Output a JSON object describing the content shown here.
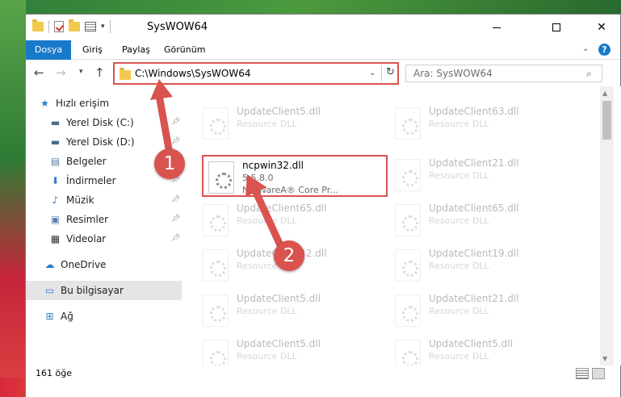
{
  "window": {
    "title": "SysWOW64"
  },
  "ribbon": {
    "tabs": [
      "Dosya",
      "Giriş",
      "Paylaş",
      "Görünüm"
    ]
  },
  "navigation": {
    "address": "C:\\Windows\\SysWOW64",
    "search_placeholder": "Ara: SysWOW64"
  },
  "sidebar": {
    "items": [
      {
        "label": "Hızlı erişim",
        "icon": "star-icon"
      },
      {
        "label": "Yerel Disk (C:)",
        "icon": "drive-icon"
      },
      {
        "label": "Yerel Disk (D:)",
        "icon": "drive-icon"
      },
      {
        "label": "Belgeler",
        "icon": "documents-icon"
      },
      {
        "label": "İndirmeler",
        "icon": "download-icon"
      },
      {
        "label": "Müzik",
        "icon": "music-icon"
      },
      {
        "label": "Resimler",
        "icon": "pictures-icon"
      },
      {
        "label": "Videolar",
        "icon": "videos-icon"
      },
      {
        "label": "OneDrive",
        "icon": "cloud-icon"
      },
      {
        "label": "Bu bilgisayar",
        "icon": "computer-icon"
      },
      {
        "label": "Ağ",
        "icon": "network-icon"
      }
    ]
  },
  "files": {
    "left": [
      {
        "name": "UpdateClient5.dll",
        "type": "Resource DLL"
      },
      {
        "name": "ncpwin32.dll",
        "version": "5.5.8.0",
        "company": "NetWareA® Core Pr..."
      },
      {
        "name": "UpdateClient65.dll",
        "type": "Resource DLL"
      },
      {
        "name": "UpdateClient42.dll",
        "type": "Resource DLL"
      },
      {
        "name": "UpdateClient5.dll",
        "type": "Resource DLL"
      },
      {
        "name": "UpdateClient5.dll",
        "type": "Resource DLL"
      }
    ],
    "right": [
      {
        "name": "UpdateClient63.dll",
        "type": "Resource DLL"
      },
      {
        "name": "UpdateClient21.dll",
        "type": "Resource DLL"
      },
      {
        "name": "UpdateClient65.dll",
        "type": "Resource DLL"
      },
      {
        "name": "UpdateClient19.dll",
        "type": "Resource DLL"
      },
      {
        "name": "UpdateClient21.dll",
        "type": "Resource DLL"
      },
      {
        "name": "UpdateClient5.dll",
        "type": "Resource DLL"
      }
    ]
  },
  "status": {
    "count": "161 öğe"
  },
  "annotations": {
    "step1": "1",
    "step2": "2",
    "color": "#d9534f"
  }
}
